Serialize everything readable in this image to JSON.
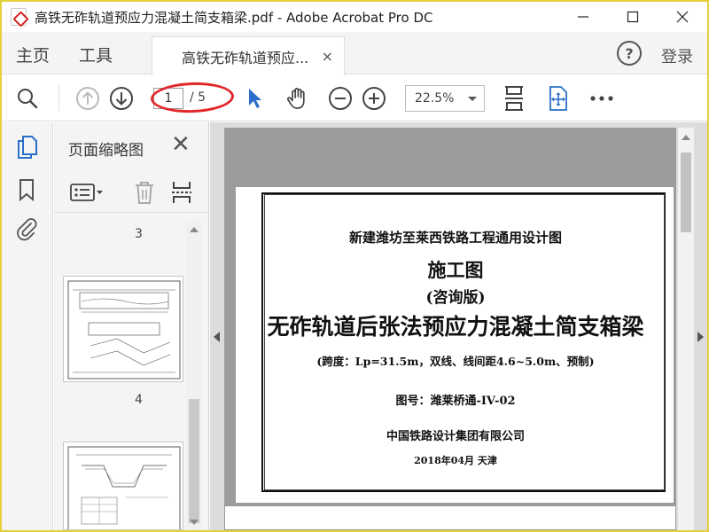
{
  "window": {
    "title": "高铁无砟轨道预应力混凝土简支箱梁.pdf - Adobe Acrobat Pro DC"
  },
  "tabs": {
    "home": "主页",
    "tools": "工具",
    "document": "高铁无砟轨道预应...",
    "close": "×",
    "login": "登录",
    "help": "?"
  },
  "toolbar": {
    "current_page": "1",
    "total_pages": "/ 5",
    "zoom": "22.5%"
  },
  "thumbnails": {
    "title": "页面缩略图",
    "labels": [
      "3",
      "4"
    ]
  },
  "document": {
    "line1": "新建潍坊至莱西铁路工程通用设计图",
    "line2": "施工图",
    "line3": "(咨询版)",
    "line4": "无砟轨道后张法预应力混凝土简支箱梁",
    "line5": "(跨度：Lp=31.5m，双线、线间距4.6~5.0m、预制)",
    "line6": "图号：潍莱桥通-IV-02",
    "line7": "中国铁路设计集团有限公司",
    "line8": "2018年04月   天津"
  },
  "colors": {
    "accent": "#2a6fc9",
    "highlight": "#e2272b"
  }
}
